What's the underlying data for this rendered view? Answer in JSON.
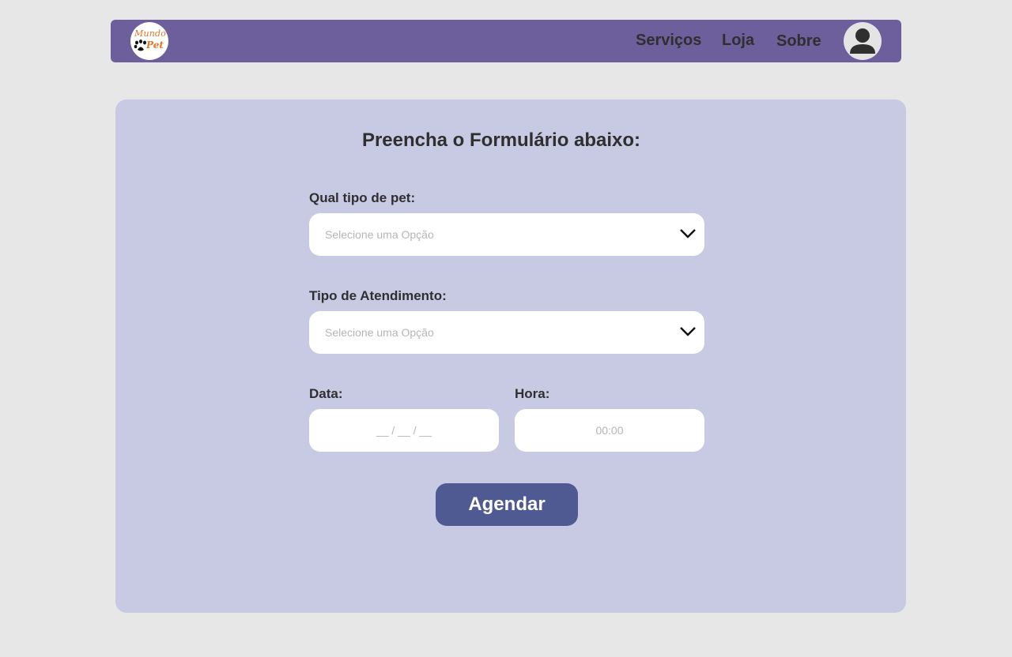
{
  "header": {
    "logo": {
      "line1": "Mundo",
      "line2": "Pet",
      "icon": "paw-icon"
    },
    "nav": [
      {
        "label": "Serviços"
      },
      {
        "label": "Loja"
      },
      {
        "label": "Sobre"
      }
    ],
    "avatar_icon": "user-icon"
  },
  "form": {
    "title": "Preencha o Formulário abaixo:",
    "pet_type": {
      "label": "Qual tipo de pet:",
      "placeholder": "Selecione uma Opção"
    },
    "service_type": {
      "label": "Tipo de Atendimento:",
      "placeholder": "Selecione uma Opção"
    },
    "date": {
      "label": "Data:",
      "placeholder": "__ / __ / __"
    },
    "time": {
      "label": "Hora:",
      "placeholder": "00:00"
    },
    "submit_label": "Agendar"
  },
  "colors": {
    "background": "#e7e7e7",
    "navbar": "#6c5f9c",
    "card": "#c8cae4",
    "button": "#4f5a93",
    "logo_accent": "#e0762b"
  }
}
